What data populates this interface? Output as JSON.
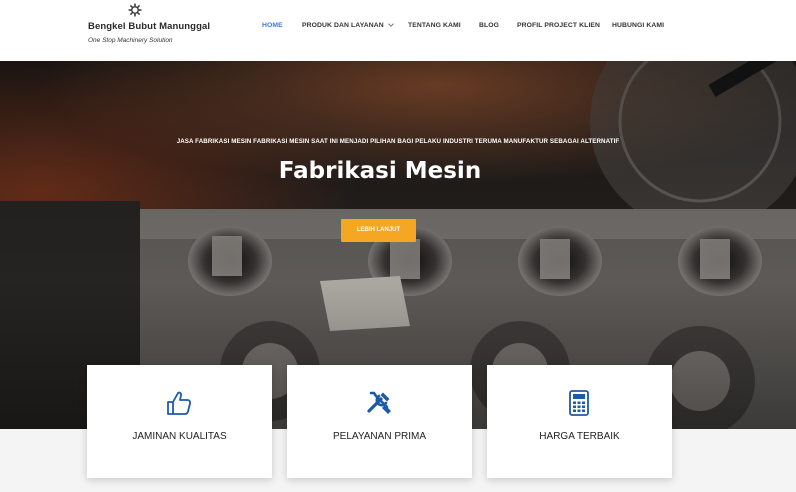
{
  "header": {
    "brand_name": "Bengkel Bubut Manunggal",
    "brand_tagline": "One Stop Machinery Solution",
    "logo_icon": "gear-icon"
  },
  "nav": {
    "items": [
      {
        "label": "HOME",
        "active": true
      },
      {
        "label": "PRODUK DAN LAYANAN",
        "has_dropdown": true,
        "dropdown_icon": "chevron-down-icon"
      },
      {
        "label": "TENTANG KAMI"
      },
      {
        "label": "BLOG"
      },
      {
        "label": "PROFIL PROJECT KLIEN"
      },
      {
        "label": "HUBUNGI KAMI"
      }
    ],
    "active_color": "#3a7bd5"
  },
  "hero": {
    "kicker": "JASA FABRIKASI MESIN FABRIKASI MESIN SAAT INI MENJADI PILIHAN BAGI PELAKU INDUSTRI TERUMA MANUFAKTUR SEBAGAI ALTERNATIF",
    "title": "Fabrikasi Mesin",
    "button_label": "LEBIH LANJUT",
    "button_color": "#f5a623"
  },
  "features": [
    {
      "label": "JAMINAN KUALITAS",
      "icon": "thumbs-up-icon"
    },
    {
      "label": "PELAYANAN PRIMA",
      "icon": "tools-icon"
    },
    {
      "label": "HARGA TERBAIK",
      "icon": "calculator-icon"
    }
  ],
  "colors": {
    "icon_blue": "#1f5aa6",
    "accent_orange": "#f5a623"
  }
}
